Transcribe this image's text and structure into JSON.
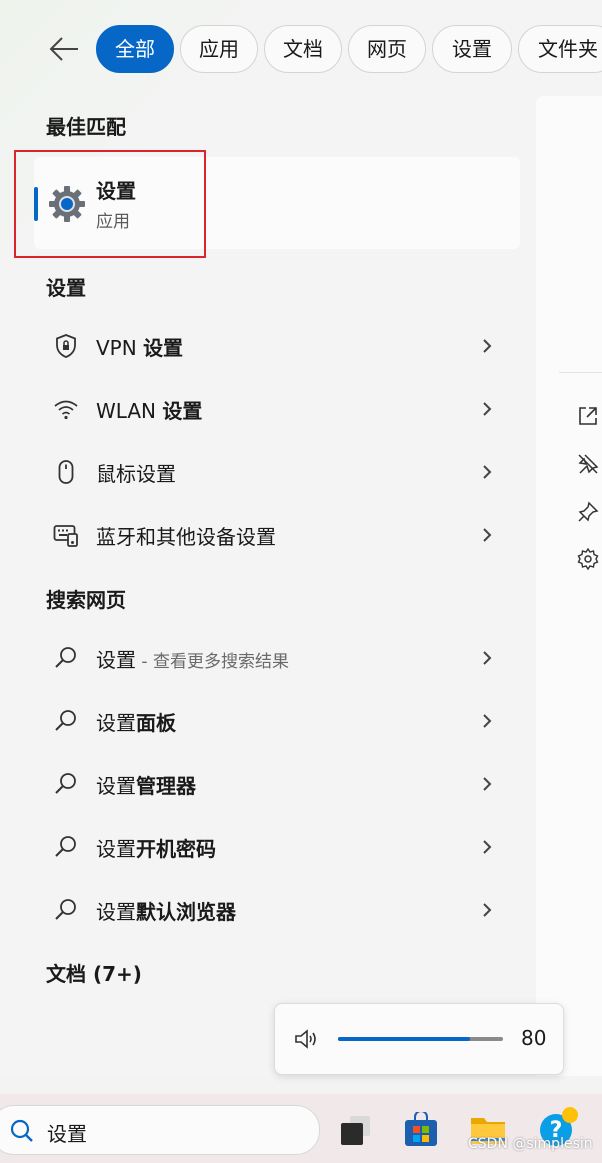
{
  "filters": {
    "back_label": "",
    "chips": [
      {
        "label": "全部",
        "active": true
      },
      {
        "label": "应用",
        "active": false
      },
      {
        "label": "文档",
        "active": false
      },
      {
        "label": "网页",
        "active": false
      },
      {
        "label": "设置",
        "active": false
      },
      {
        "label": "文件夹",
        "active": false
      }
    ]
  },
  "best_match": {
    "heading": "最佳匹配",
    "title": "设置",
    "subtitle": "应用",
    "icon": "gear-icon"
  },
  "settings_section": {
    "heading": "设置",
    "items": [
      {
        "label_plain": "VPN ",
        "label_bold": "设置",
        "icon": "shield-lock-icon"
      },
      {
        "label_plain": "WLAN ",
        "label_bold": "设置",
        "icon": "wifi-icon"
      },
      {
        "label_plain": "鼠标设置",
        "label_bold": "",
        "icon": "mouse-icon"
      },
      {
        "label_plain": "蓝牙和其他设备设置",
        "label_bold": "",
        "icon": "devices-icon"
      }
    ]
  },
  "web_section": {
    "heading": "搜索网页",
    "items": [
      {
        "label": "设置",
        "bold": "",
        "hint": " - 查看更多搜索结果"
      },
      {
        "label": "设置",
        "bold": "面板",
        "hint": ""
      },
      {
        "label": "设置",
        "bold": "管理器",
        "hint": ""
      },
      {
        "label": "设置",
        "bold": "开机密码",
        "hint": ""
      },
      {
        "label": "设置",
        "bold": "默认浏览器",
        "hint": ""
      }
    ]
  },
  "documents_section": {
    "heading": "文档 (7+)"
  },
  "volume": {
    "value_text": "80",
    "level": 0.8
  },
  "taskbar": {
    "search_value": "设置"
  },
  "watermark": "CSDN @simplesin",
  "colors": {
    "accent": "#0767c6",
    "highlight_border": "#d9252b"
  }
}
